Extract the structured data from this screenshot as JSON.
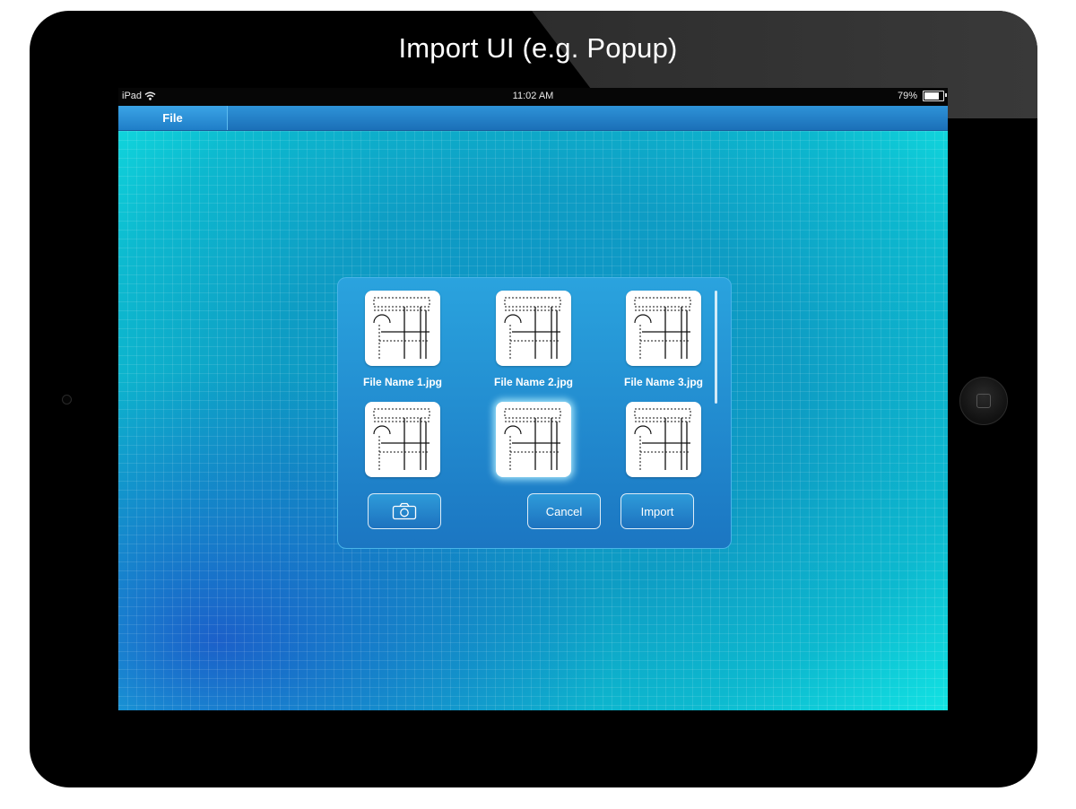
{
  "mockup_title": "Import UI (e.g. Popup)",
  "status_bar": {
    "carrier": "iPad",
    "time": "11:02 AM",
    "battery": "79%",
    "battery_level": 0.79
  },
  "menu": {
    "file_label": "File"
  },
  "popup": {
    "files": [
      {
        "name": "File Name 1.jpg",
        "selected": false
      },
      {
        "name": "File Name 2.jpg",
        "selected": false
      },
      {
        "name": "File Name 3.jpg",
        "selected": false
      },
      {
        "name": "",
        "selected": false
      },
      {
        "name": "",
        "selected": true
      },
      {
        "name": "",
        "selected": false
      }
    ],
    "camera_icon": "camera-icon",
    "cancel_label": "Cancel",
    "import_label": "Import"
  },
  "colors": {
    "device": "#000000",
    "menubar": "#1f7ec8",
    "popup": "#2290d2",
    "canvas": "#0ea8cc",
    "accent_glow": "#12e3e3"
  }
}
